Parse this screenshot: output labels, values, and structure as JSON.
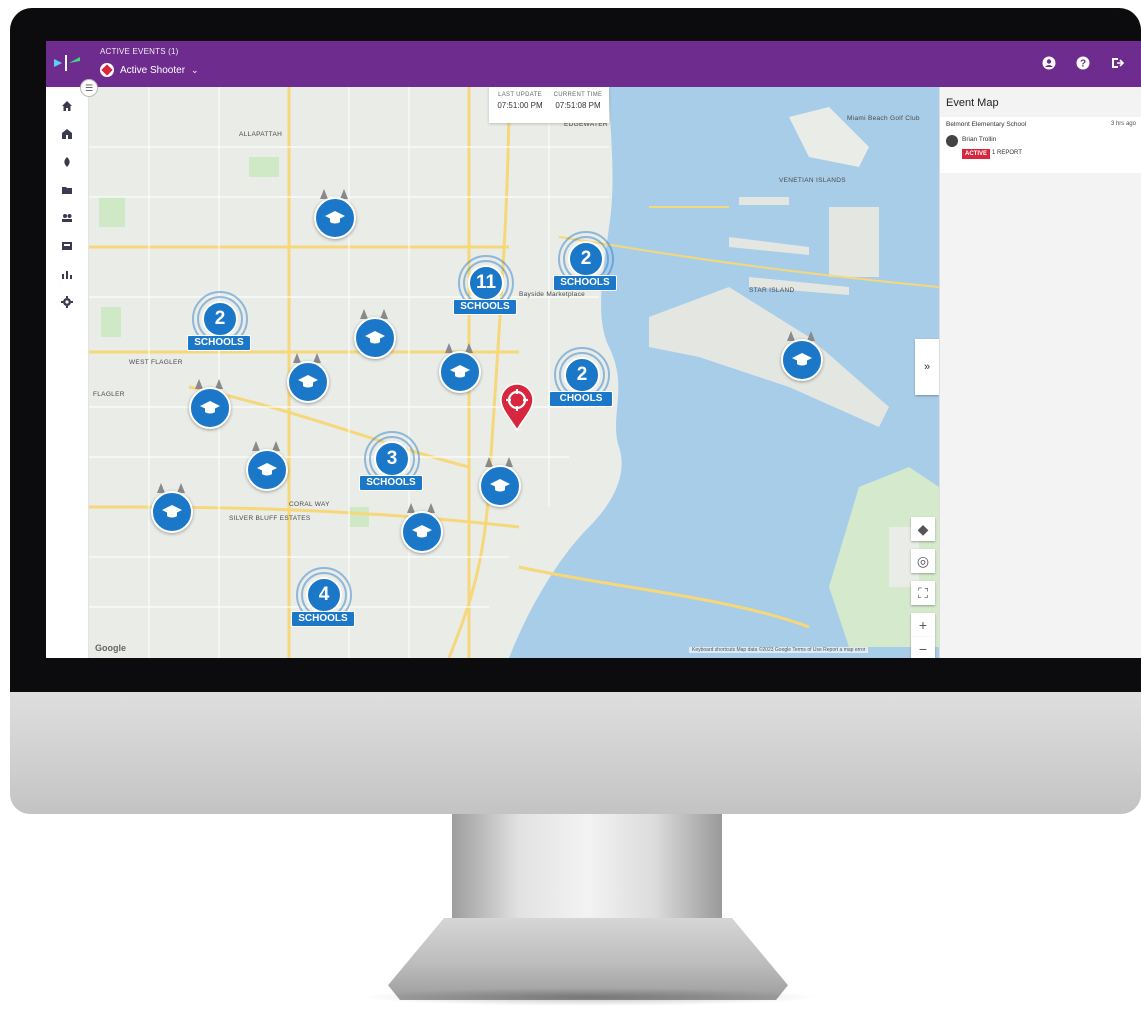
{
  "header": {
    "events_label": "ACTIVE EVENTS (1)",
    "event_name": "Active Shooter",
    "icons": [
      "account-circle-icon",
      "help-icon",
      "logout-icon"
    ]
  },
  "sidebar": {
    "items": [
      {
        "icon": "home-icon"
      },
      {
        "icon": "school-icon"
      },
      {
        "icon": "alert-icon"
      },
      {
        "icon": "folder-icon"
      },
      {
        "icon": "users-icon"
      },
      {
        "icon": "inbox-icon"
      },
      {
        "icon": "analytics-icon"
      },
      {
        "icon": "settings-icon"
      }
    ]
  },
  "update_box": {
    "last_update_label": "LAST UPDATE",
    "last_update_value": "07:51:00 PM",
    "current_time_label": "CURRENT TIME",
    "current_time_value": "07:51:08 PM"
  },
  "map": {
    "labels": [
      "ALLAPATTAH",
      "EDGEWATER",
      "WEST FLAGLER",
      "FLAGLER",
      "CORAL WAY",
      "SILVER BLUFF ESTATES",
      "VENETIAN ISLANDS",
      "STAR ISLAND",
      "Bayside Marketplace",
      "Miami Beach Golf Club"
    ],
    "clusters": [
      {
        "count": "2",
        "label": "SCHOOLS"
      },
      {
        "count": "11",
        "label": "SCHOOLS"
      },
      {
        "count": "2",
        "label": "SCHOOLS"
      },
      {
        "count": "2",
        "label": "CHOOLS"
      },
      {
        "count": "3",
        "label": "SCHOOLS"
      },
      {
        "count": "4",
        "label": "SCHOOLS"
      }
    ],
    "school_pin_icon": "graduation-cap-icon",
    "incident_icon": "crosshair-icon",
    "google_label": "Google",
    "attribution": "Keyboard shortcuts  Map data ©2023 Google  Terms of Use  Report a map error",
    "colors": {
      "water": "#a8cde8",
      "land": "#e9ece7",
      "park": "#cfe8c5",
      "road": "#f6d77a",
      "cluster": "#1b78c8",
      "incident": "#d7263d"
    }
  },
  "panel": {
    "title": "Event Map",
    "school_name": "Belmont Elementary School",
    "elapsed": "3 hrs ago",
    "reporter": "Brian Trollin",
    "status": "ACTIVE",
    "reports": "1 REPORT"
  },
  "theme": {
    "header_purple": "#6e2c8f",
    "accent_red": "#d7263d"
  }
}
